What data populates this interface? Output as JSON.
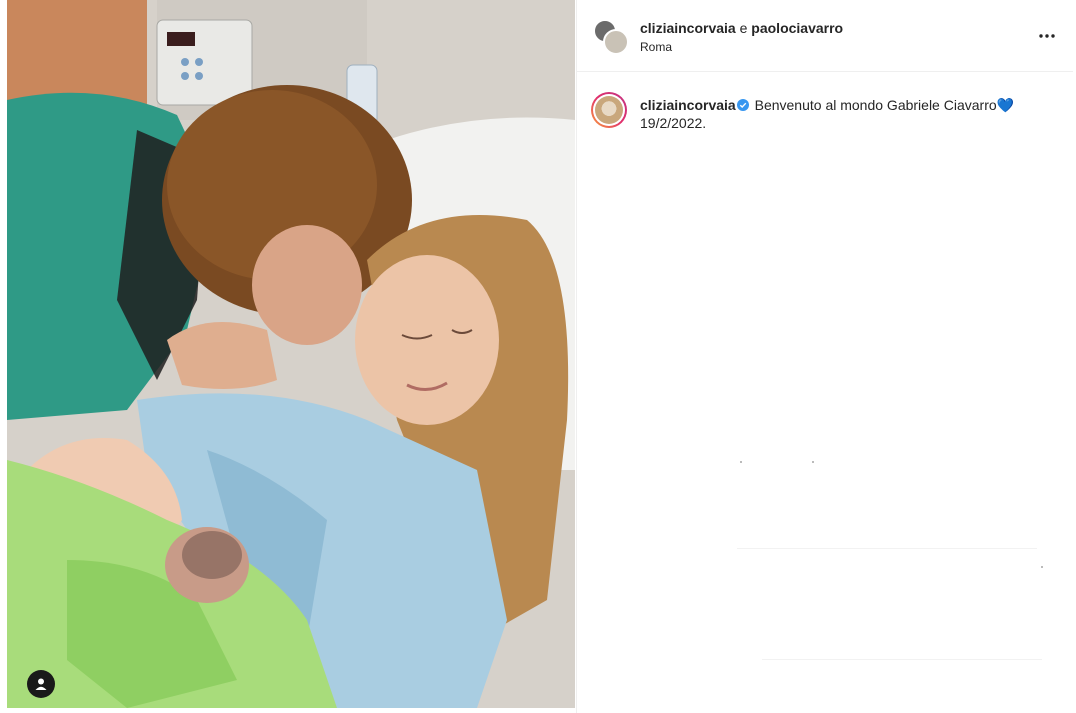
{
  "post": {
    "header": {
      "author_primary": "cliziaincorvaia",
      "joiner": "e",
      "author_secondary": "paolociavarro",
      "location": "Roma"
    },
    "caption": {
      "username": "cliziaincorvaia",
      "text": "Benvenuto al mondo Gabriele Ciavarro",
      "emoji": "💙",
      "date_line": "19/2/2022."
    },
    "icons": {
      "verified": "verified-badge-icon",
      "more": "more-options-icon",
      "tags": "user-tag-icon"
    },
    "colors": {
      "verified_blue": "#3897f0",
      "heart_blue": "#1e88e5",
      "text": "#262626",
      "divider": "#efefef"
    }
  }
}
